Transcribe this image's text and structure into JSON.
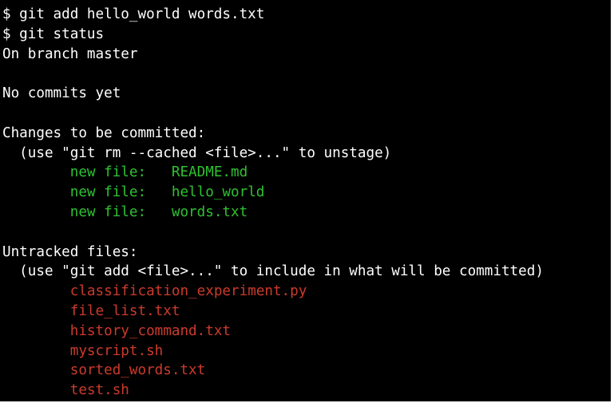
{
  "colors": {
    "background": "#000000",
    "text": "#ffffff",
    "staged": "#2ec231",
    "untracked": "#cc3a2c"
  },
  "terminal": {
    "commands": {
      "add": "$ git add hello_world words.txt",
      "status": "$ git status"
    },
    "status": {
      "branch_line": "On branch master",
      "no_commits_line": "No commits yet",
      "staged_header": "Changes to be committed:",
      "staged_hint": "  (use \"git rm --cached <file>...\" to unstage)",
      "staged_files": [
        "\tnew file:   README.md",
        "\tnew file:   hello_world",
        "\tnew file:   words.txt"
      ],
      "untracked_header": "Untracked files:",
      "untracked_hint": "  (use \"git add <file>...\" to include in what will be committed)",
      "untracked_files": [
        "\tclassification_experiment.py",
        "\tfile_list.txt",
        "\thistory_command.txt",
        "\tmyscript.sh",
        "\tsorted_words.txt",
        "\ttest.sh"
      ]
    }
  }
}
